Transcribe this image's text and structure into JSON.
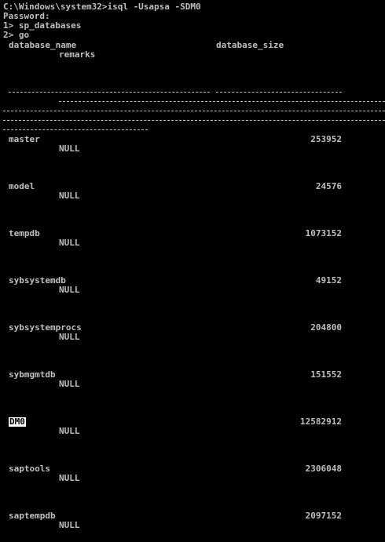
{
  "console": {
    "command_line": "C:\\Windows\\system32>isql -Usapsa -SDM0",
    "password_prompt": "Password:",
    "line1": "1> sp_databases",
    "line2": "2> go"
  },
  "columns": {
    "name": "database_name",
    "size": "database_size",
    "remarks": "remarks"
  },
  "databases": [
    {
      "name": "master",
      "size": "253952",
      "remarks": "NULL"
    },
    {
      "name": "model",
      "size": "24576",
      "remarks": "NULL"
    },
    {
      "name": "tempdb",
      "size": "1073152",
      "remarks": "NULL"
    },
    {
      "name": "sybsystemdb",
      "size": "49152",
      "remarks": "NULL"
    },
    {
      "name": "sybsystemprocs",
      "size": "204800",
      "remarks": "NULL"
    },
    {
      "name": "sybmgmtdb",
      "size": "151552",
      "remarks": "NULL"
    },
    {
      "name": "DM0",
      "size": "12582912",
      "remarks": "NULL"
    },
    {
      "name": "saptools",
      "size": "2306048",
      "remarks": "NULL"
    },
    {
      "name": "saptempdb",
      "size": "2097152",
      "remarks": "NULL"
    }
  ]
}
